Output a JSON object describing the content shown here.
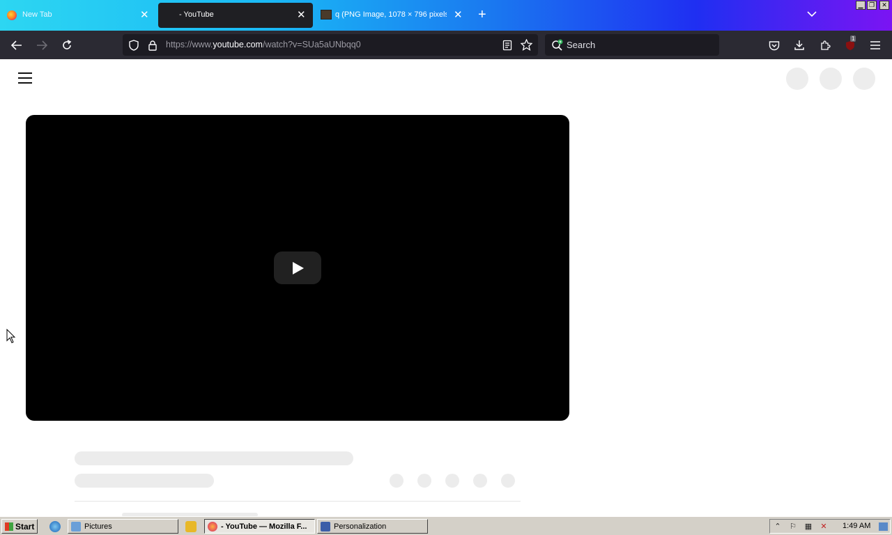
{
  "browser": {
    "tabs": [
      {
        "title": "New Tab",
        "active": false,
        "icon": "firefox-icon"
      },
      {
        "title": "- YouTube",
        "active": true,
        "icon": "none"
      },
      {
        "title": "q (PNG Image, 1078 × 796 pixels)",
        "active": false,
        "icon": "image-thumbnail-icon"
      }
    ],
    "url": {
      "prefix": "https://www.",
      "host": "youtube.com",
      "path": "/watch?v=SUa5aUNbqq0"
    },
    "search_placeholder": "Search",
    "extension_badge": "1"
  },
  "colors": {
    "tabstrip_gradient": [
      "#2dd6f2",
      "#1a79f0",
      "#7b14f3"
    ],
    "toolbar": "#2b2a33",
    "field": "#1c1b22",
    "player": "#000000",
    "skeleton": "#ececec",
    "taskbar": "#d4d0c8"
  },
  "taskbar": {
    "start_label": "Start",
    "items": [
      {
        "label": "Pictures",
        "active": false
      },
      {
        "label": "- YouTube — Mozilla F...",
        "active": true
      },
      {
        "label": "Personalization",
        "active": false
      }
    ],
    "clock": "1:49 AM"
  }
}
